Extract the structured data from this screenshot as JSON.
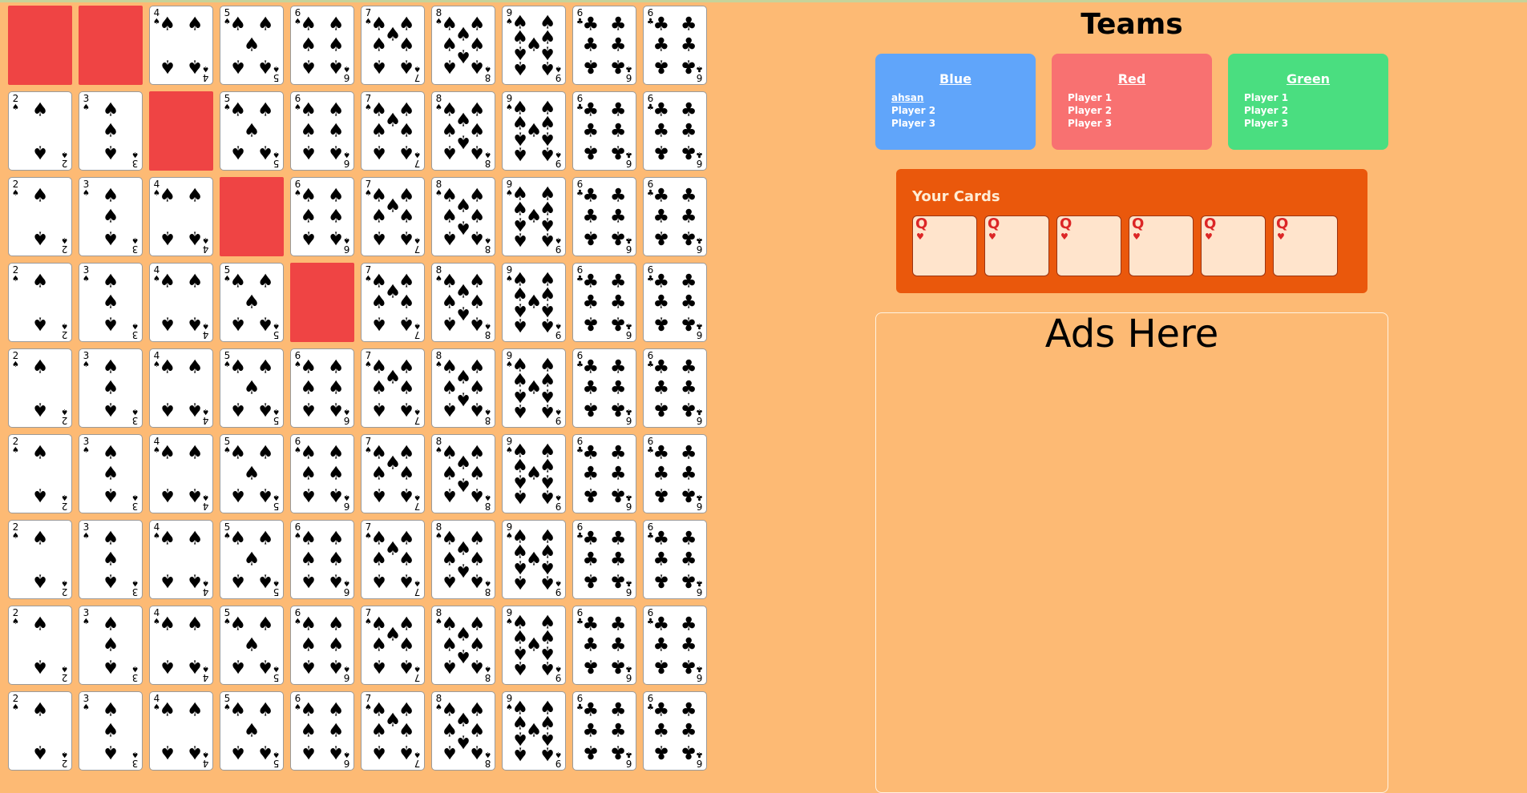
{
  "board": {
    "columns": [
      {
        "rank": "2",
        "suit": "♠"
      },
      {
        "rank": "3",
        "suit": "♠"
      },
      {
        "rank": "4",
        "suit": "♠"
      },
      {
        "rank": "5",
        "suit": "♠"
      },
      {
        "rank": "6",
        "suit": "♠"
      },
      {
        "rank": "7",
        "suit": "♠"
      },
      {
        "rank": "8",
        "suit": "♠"
      },
      {
        "rank": "9",
        "suit": "♠"
      },
      {
        "rank": "6",
        "suit": "♣"
      },
      {
        "rank": "6",
        "suit": "♣"
      }
    ],
    "row_count": 9,
    "red_cells": [
      [
        0,
        0
      ],
      [
        0,
        1
      ],
      [
        1,
        2
      ],
      [
        2,
        3
      ],
      [
        3,
        4
      ]
    ],
    "red_color": "#ef4444"
  },
  "teams": {
    "title": "Teams",
    "list": [
      {
        "name": "Blue",
        "color": "#60a5fa",
        "players": [
          "ahsan",
          "Player 2",
          "Player 3"
        ],
        "current_player": "ahsan"
      },
      {
        "name": "Red",
        "color": "#f87171",
        "players": [
          "Player 1",
          "Player 2",
          "Player 3"
        ]
      },
      {
        "name": "Green",
        "color": "#4ade80",
        "players": [
          "Player 1",
          "Player 2",
          "Player 3"
        ]
      }
    ]
  },
  "your_cards": {
    "title": "Your Cards",
    "cards": [
      {
        "rank": "Q",
        "suit": "♥"
      },
      {
        "rank": "Q",
        "suit": "♥"
      },
      {
        "rank": "Q",
        "suit": "♥"
      },
      {
        "rank": "Q",
        "suit": "♥"
      },
      {
        "rank": "Q",
        "suit": "♥"
      },
      {
        "rank": "Q",
        "suit": "♥"
      }
    ]
  },
  "ads": {
    "text": "Ads Here"
  }
}
